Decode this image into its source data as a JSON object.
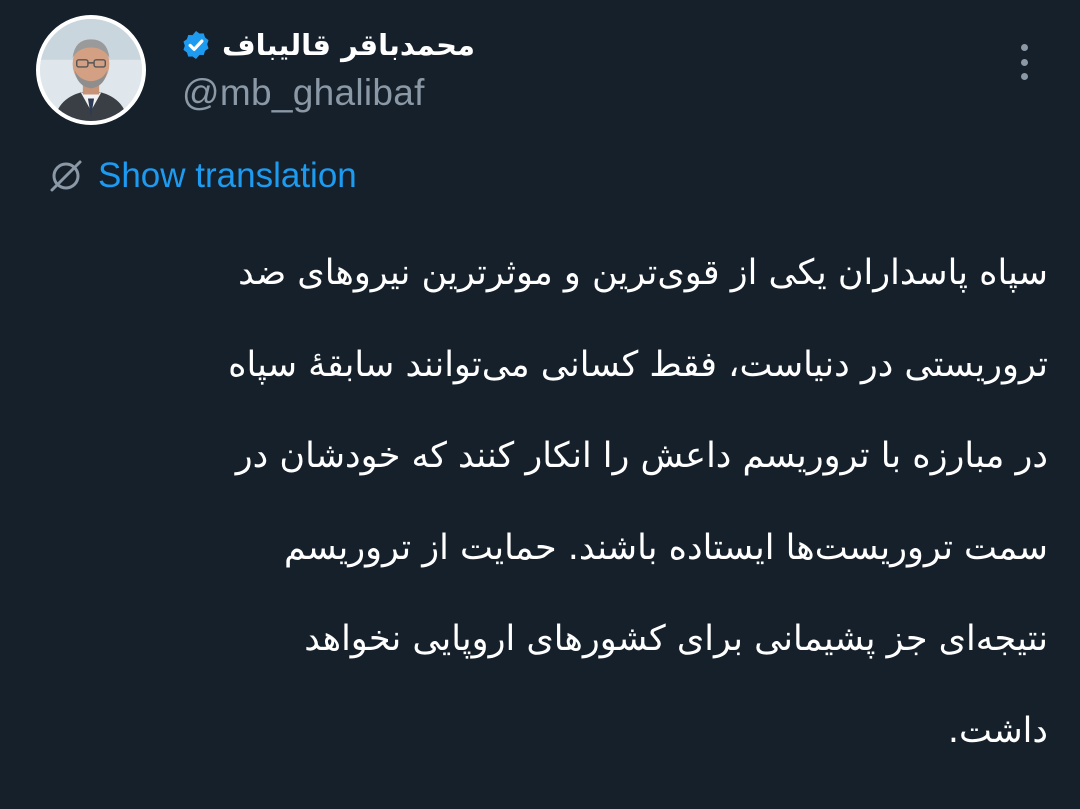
{
  "tweet": {
    "author": {
      "display_name": "محمدباقر قالیباف",
      "handle": "@mb_ghalibaf",
      "verified": true,
      "verified_icon": "verified-badge-icon",
      "avatar": "profile-photo"
    },
    "more_icon": "more-options-icon",
    "translation": {
      "icon": "translate-globe-icon",
      "label": "Show translation"
    },
    "text_lines": [
      "سپاه پاسداران یکی از قوی‌ترین و موثرترین نیروهای ضد",
      "تروریستی در دنیاست، فقط کسانی می‌توانند سابقهٔ سپاه",
      "در مبارزه با تروریسم داعش را انکار کنند که خودشان در",
      "سمت تروریست‌ها ایستاده باشند. حمایت از تروریسم",
      "نتیجه‌ای جز پشیمانی برای کشورهای اروپایی نخواهد",
      "داشت."
    ]
  },
  "colors": {
    "background": "#15202b",
    "primary_text": "#ffffff",
    "secondary_text": "#8b98a5",
    "link": "#1d9bf0",
    "verified_badge": "#1d9bf0"
  }
}
